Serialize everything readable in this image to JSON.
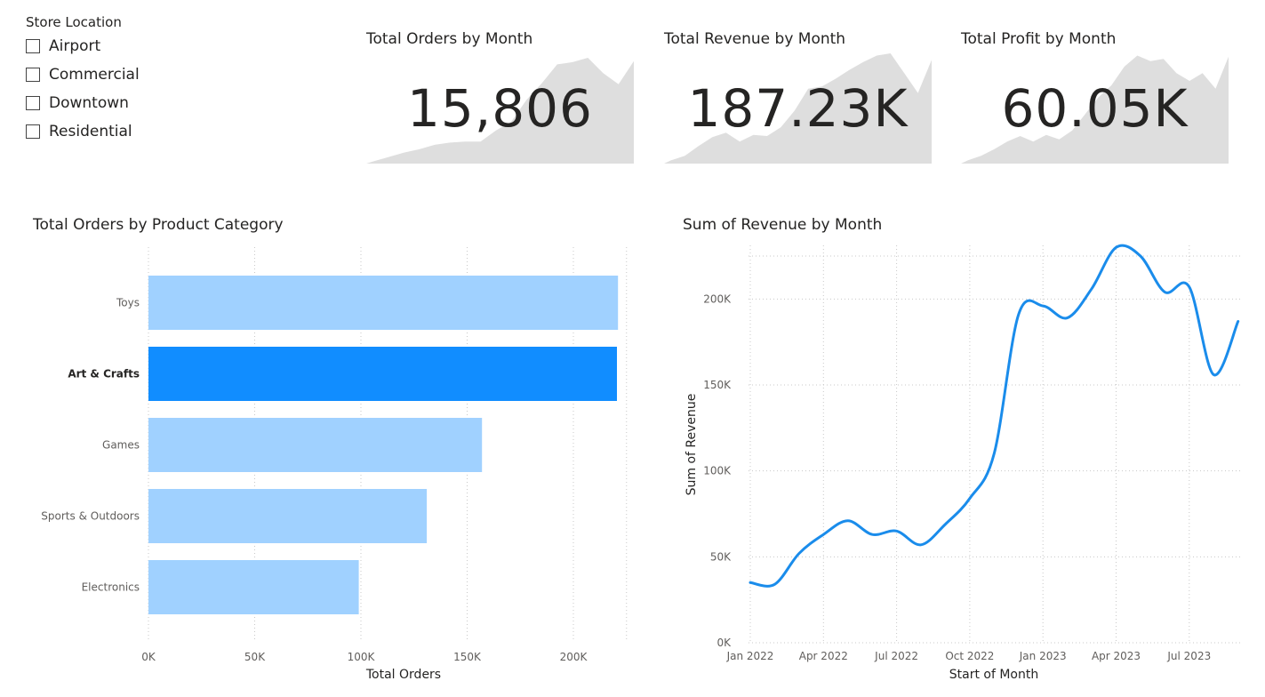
{
  "slicer": {
    "title": "Store Location",
    "items": [
      {
        "label": "Airport",
        "checked": false
      },
      {
        "label": "Commercial",
        "checked": false
      },
      {
        "label": "Downtown",
        "checked": false
      },
      {
        "label": "Residential",
        "checked": false
      }
    ]
  },
  "kpis": [
    {
      "title": "Total Orders by Month",
      "value": "15,806",
      "trend": [
        2,
        6,
        10,
        13,
        17,
        19,
        20,
        20,
        30,
        38,
        58,
        73,
        90,
        92,
        96,
        82,
        72,
        93
      ]
    },
    {
      "title": "Total Revenue by Month",
      "value": "187.23K",
      "trend": [
        3,
        7,
        16,
        24,
        28,
        20,
        26,
        25,
        33,
        48,
        68,
        70,
        77,
        85,
        92,
        98,
        100,
        82,
        64,
        94
      ]
    },
    {
      "title": "Total Profit by Month",
      "value": "60.05K",
      "trend": [
        3,
        7,
        13,
        20,
        25,
        20,
        26,
        22,
        30,
        45,
        60,
        71,
        88,
        98,
        93,
        95,
        82,
        75,
        82,
        68,
        97
      ]
    }
  ],
  "colors": {
    "bar_light": "#a0d1ff",
    "bar_selected": "#118dff",
    "line": "#1a8ceb",
    "spark": "#dedede",
    "grid": "#c8c8c8",
    "tick": "#605e5c"
  },
  "chart_data": [
    {
      "type": "bar",
      "orientation": "horizontal",
      "title": "Total Orders by Product Category",
      "categories": [
        "Toys",
        "Art & Crafts",
        "Games",
        "Sports & Outdoors",
        "Electronics"
      ],
      "values": [
        221000,
        220500,
        157000,
        131000,
        99000
      ],
      "selected": "Art & Crafts",
      "xlabel": "Total Orders",
      "ylabel": "",
      "xlim": [
        0,
        220000
      ],
      "xticks": [
        0,
        50000,
        100000,
        150000,
        200000
      ],
      "xtick_labels": [
        "0K",
        "50K",
        "100K",
        "150K",
        "200K"
      ],
      "grid": true
    },
    {
      "type": "line",
      "title": "Sum of Revenue by Month",
      "x": [
        "2022-01",
        "2022-02",
        "2022-03",
        "2022-04",
        "2022-05",
        "2022-06",
        "2022-07",
        "2022-08",
        "2022-09",
        "2022-10",
        "2022-11",
        "2022-12",
        "2023-01",
        "2023-02",
        "2023-03",
        "2023-04",
        "2023-05",
        "2023-06",
        "2023-07",
        "2023-08",
        "2023-09"
      ],
      "values": [
        35000,
        34000,
        52000,
        63000,
        71000,
        63000,
        65000,
        57000,
        69000,
        84000,
        110000,
        191000,
        196000,
        189000,
        206000,
        230000,
        225000,
        204000,
        207000,
        156000,
        187000
      ],
      "xlabel": "Start of Month",
      "ylabel": "Sum of Revenue",
      "ylim": [
        0,
        230000
      ],
      "yticks": [
        0,
        50000,
        100000,
        150000,
        200000
      ],
      "ytick_labels": [
        "0K",
        "50K",
        "100K",
        "150K",
        "200K"
      ],
      "xtick_labels": [
        "Jan 2022",
        "Apr 2022",
        "Jul 2022",
        "Oct 2022",
        "Jan 2023",
        "Apr 2023",
        "Jul 2023"
      ],
      "grid": true
    }
  ]
}
